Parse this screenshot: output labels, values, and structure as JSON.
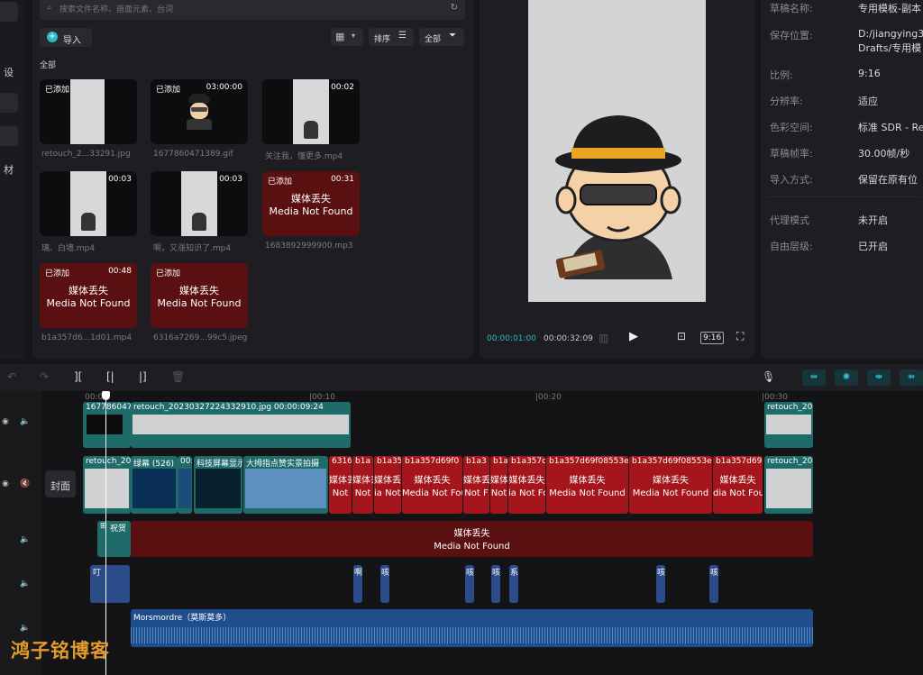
{
  "media": {
    "search_placeholder": "搜索文件名称、画面元素、台词",
    "import_label": "导入",
    "sort_label": "排序",
    "filter_label": "全部",
    "section_label": "全部",
    "left_tabs": [
      "设",
      "材"
    ],
    "items": [
      {
        "badge": "已添加",
        "duration": "",
        "name": "retouch_2...33291.jpg"
      },
      {
        "badge": "已添加",
        "duration": "03:00:00",
        "name": "1677860471389.gif"
      },
      {
        "badge": "",
        "duration": "00:02",
        "name": "关注我，懂更多.mp4"
      },
      {
        "badge": "",
        "duration": "00:03",
        "name": "璃、白墙.mp4"
      },
      {
        "badge": "",
        "duration": "00:03",
        "name": "啊，又涨知识了.mp4"
      },
      {
        "badge": "已添加",
        "duration": "00:31",
        "name": "1683892999900.mp3",
        "missing": "媒体丢失\nMedia Not Found"
      },
      {
        "badge": "已添加",
        "duration": "00:48",
        "name": "b1a357d6...1d01.mp4",
        "missing": "媒体丢失\nMedia Not Found"
      },
      {
        "badge": "已添加",
        "duration": "",
        "name": "6316a7269...99c5.jpeg",
        "missing": "媒体丢失\nMedia Not Found"
      }
    ]
  },
  "player": {
    "current_time": "00:00:01:00",
    "total_time": "00:00:32:09",
    "ratio_btn": "9:16"
  },
  "properties": [
    {
      "key": "草稿名称:",
      "value": "专用模板-副本"
    },
    {
      "key": "保存位置:",
      "value": "D:/jiangying3",
      "value2": "Drafts/专用模"
    },
    {
      "key": "比例:",
      "value": "9:16"
    },
    {
      "key": "分辨率:",
      "value": "适应"
    },
    {
      "key": "色彩空间:",
      "value": "标准 SDR - Re"
    },
    {
      "key": "草稿帧率:",
      "value": "30.00帧/秒"
    },
    {
      "key": "导入方式:",
      "value": "保留在原有位"
    },
    {
      "key": "代理模式",
      "value": "未开启"
    },
    {
      "key": "自由层级:",
      "value": "已开启"
    }
  ],
  "timeline": {
    "ruler": [
      "00:00",
      "|00:10",
      "|00:20",
      "|00:30"
    ],
    "cover_label": "封面",
    "track1": [
      {
        "label": "167786047"
      },
      {
        "label": "retouch_20230327224332910.jpg  00:00:09:24"
      },
      {
        "label": "retouch_20"
      }
    ],
    "track2_labels": [
      "retouch_20",
      "绿幕 (526)",
      "00:",
      "科技屏幕显示",
      "大拇指点赞实景拍摄",
      "6316",
      "b1a",
      "b1a35",
      "b1a357d69f0",
      "b1a3",
      "b1a",
      "b1a357c",
      "b1a357d69f08553e",
      "b1a357d69f08553e",
      "b1a357d69",
      "retouch_20"
    ],
    "track2_missing": [
      "媒体丢失",
      "Not",
      "ia Not F",
      "Media Not Found",
      "Not F",
      "ia Not Fo",
      "dia Not Fou"
    ],
    "track3_text_label": "祝贺",
    "track3_missing": [
      "媒体丢失",
      "Media Not Found"
    ],
    "sfx_labels": [
      "叮",
      "啊",
      "咳",
      "咳",
      "咳",
      "系",
      "咳",
      "咳"
    ],
    "music_label": "Morsmordre（莫斯莫多）"
  },
  "watermark": "鸿子铭博客",
  "colors": {
    "accent": "#2fb8c9",
    "missing": "#a4161c",
    "video": "#1e6b6a",
    "audio": "#2a4d8a"
  }
}
